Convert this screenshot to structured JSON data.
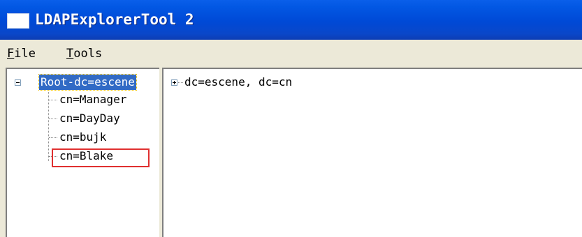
{
  "window": {
    "title": "LDAPExplorerTool 2"
  },
  "menu": [
    {
      "first": "F",
      "rest": "ile"
    },
    {
      "first": "T",
      "rest": "ools"
    }
  ],
  "tree": {
    "root_label": "Root-dc=escene",
    "children": [
      "cn=Manager",
      "cn=DayDay",
      "cn=bujk",
      "cn=Blake"
    ]
  },
  "right_tree": {
    "node_label": "dc=escene, dc=cn"
  },
  "icons": {
    "app": "app-window-icon",
    "collapse": "minus-expander-icon",
    "expand": "plus-expander-icon"
  },
  "colors": {
    "titlebar": "#0049d6",
    "selection": "#316ac5",
    "highlight": "#e03030"
  }
}
